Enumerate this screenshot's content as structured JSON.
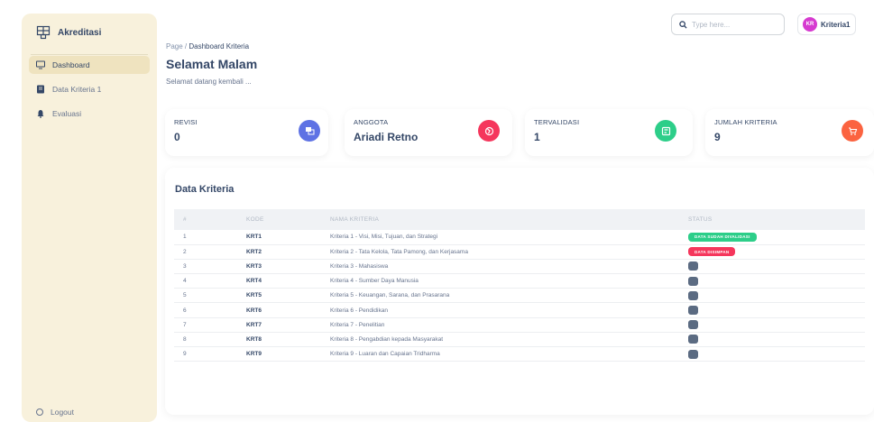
{
  "sidebar": {
    "brand": "Akreditasi",
    "items": [
      {
        "label": "Dashboard",
        "icon": "monitor-icon",
        "active": true
      },
      {
        "label": "Data Kriteria 1",
        "icon": "document-icon",
        "active": false
      },
      {
        "label": "Evaluasi",
        "icon": "bell-icon",
        "active": false
      }
    ],
    "logout": "Logout"
  },
  "header": {
    "breadcrumb_root": "Page",
    "breadcrumb_current": "Dashboard Kriteria",
    "title": "Selamat Malam",
    "subtitle": "Selamat datang kembali ...",
    "search_placeholder": "Type here...",
    "user_initials": "KR",
    "user_name": "Kriteria1"
  },
  "stats": [
    {
      "label": "REVISI",
      "value": "0",
      "icon": "layers-icon",
      "color": "#5e72e4"
    },
    {
      "label": "ANGGOTA",
      "value": "Ariadi Retno",
      "icon": "globe-icon",
      "color": "#f5365c"
    },
    {
      "label": "TERVALIDASI",
      "value": "1",
      "icon": "checklist-icon",
      "color": "#2dce89"
    },
    {
      "label": "JUMLAH KRITERIA",
      "value": "9",
      "icon": "cart-icon",
      "color": "#fb6340"
    }
  ],
  "table": {
    "title": "Data Kriteria",
    "headers": [
      "#",
      "KODE",
      "NAMA KRITERIA",
      "STATUS"
    ],
    "rows": [
      {
        "num": "1",
        "kode": "KRT1",
        "nama": "Kriteria 1 - Visi, Misi, Tujuan, dan Strategi",
        "status": "DATA SUDAH DIVALIDASI",
        "status_type": "green"
      },
      {
        "num": "2",
        "kode": "KRT2",
        "nama": "Kriteria 2 - Tata Kelola, Tata Pamong, dan Kerjasama",
        "status": "DATA DISIMPAN",
        "status_type": "red"
      },
      {
        "num": "3",
        "kode": "KRT3",
        "nama": "Kriteria 3 - Mahasiswa",
        "status": "",
        "status_type": "empty"
      },
      {
        "num": "4",
        "kode": "KRT4",
        "nama": "Kriteria 4 - Sumber Daya Manusia",
        "status": "",
        "status_type": "empty"
      },
      {
        "num": "5",
        "kode": "KRT5",
        "nama": "Kriteria 5 - Keuangan, Sarana, dan Prasarana",
        "status": "",
        "status_type": "empty"
      },
      {
        "num": "6",
        "kode": "KRT6",
        "nama": "Kriteria 6 - Pendidikan",
        "status": "",
        "status_type": "empty"
      },
      {
        "num": "7",
        "kode": "KRT7",
        "nama": "Kriteria 7 - Penelitian",
        "status": "",
        "status_type": "empty"
      },
      {
        "num": "8",
        "kode": "KRT8",
        "nama": "Kriteria 8 - Pengabdian kepada Masyarakat",
        "status": "",
        "status_type": "empty"
      },
      {
        "num": "9",
        "kode": "KRT9",
        "nama": "Kriteria 9 - Luaran dan Capaian Tridharma",
        "status": "",
        "status_type": "empty"
      }
    ]
  }
}
